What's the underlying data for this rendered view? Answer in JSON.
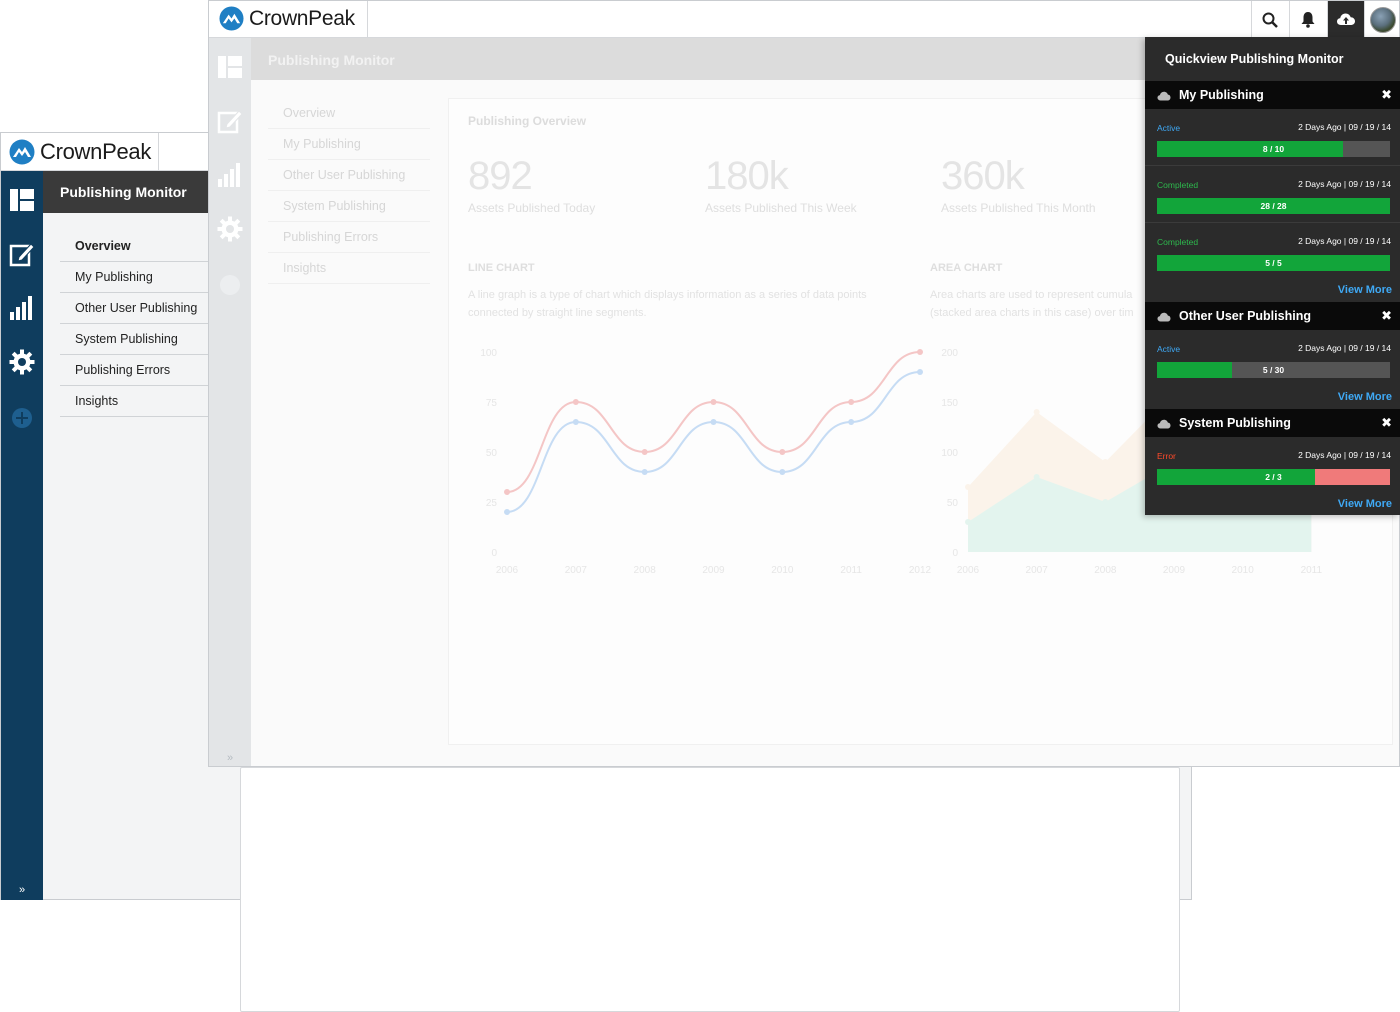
{
  "brand": {
    "name": "CrownPeak"
  },
  "back_window": {
    "title": "Publishing Monitor",
    "nav": [
      "Overview",
      "My Publishing",
      "Other User Publishing",
      "System Publishing",
      "Publishing Errors",
      "Insights"
    ],
    "expand_glyph": "»"
  },
  "front_window": {
    "title": "Publishing Monitor",
    "nav": [
      "Overview",
      "My Publishing",
      "Other User Publishing",
      "System Publishing",
      "Publishing Errors",
      "Insights"
    ],
    "expand_glyph": "»",
    "header_icons": [
      "search-icon",
      "bell-icon",
      "cloud-upload-icon",
      "avatar"
    ],
    "overview": {
      "title": "Publishing Overview",
      "stats": [
        {
          "value": "892",
          "label": "Assets Published Today"
        },
        {
          "value": "180k",
          "label": "Assets Published This Week"
        },
        {
          "value": "360k",
          "label": "Assets Published This Month"
        }
      ],
      "line_chart": {
        "title": "LINE CHART",
        "desc_1": "A line graph is a type of chart which displays information as a series of data points",
        "desc_2": "connected by straight line segments."
      },
      "area_chart": {
        "title": "AREA CHART",
        "desc_1": "Area charts are used to represent cumula",
        "desc_2": "(stacked area charts in this case) over tim"
      }
    }
  },
  "chart_data": [
    {
      "type": "line",
      "title": "LINE CHART",
      "x": [
        "2006",
        "2007",
        "2008",
        "2009",
        "2010",
        "2011",
        "2012"
      ],
      "ylim": [
        0,
        100
      ],
      "yticks": [
        "0",
        "25",
        "50",
        "75",
        "100"
      ],
      "series": [
        {
          "values": [
            30,
            75,
            50,
            75,
            50,
            75,
            100
          ],
          "color": "#f4c6c6"
        },
        {
          "values": [
            20,
            65,
            40,
            65,
            40,
            65,
            90
          ],
          "color": "#c6dcf4"
        }
      ]
    },
    {
      "type": "area",
      "title": "AREA CHART",
      "x": [
        "2006",
        "2007",
        "2008",
        "2009",
        "2010",
        "2011"
      ],
      "ylim": [
        0,
        200
      ],
      "yticks": [
        "0",
        "50",
        "100",
        "150",
        "200"
      ],
      "series": [
        {
          "values": [
            65,
            140,
            90,
            160,
            180,
            190
          ],
          "color": "#fbf3ea"
        },
        {
          "values": [
            30,
            75,
            50,
            90,
            110,
            120
          ],
          "color": "#e3f4ee"
        }
      ]
    }
  ],
  "quickview": {
    "title": "Quickview Publishing Monitor",
    "sections": [
      {
        "name": "My Publishing",
        "items": [
          {
            "status": "Active",
            "status_color": "#3fa9f5",
            "date": "2 Days Ago | 09 / 19 / 14",
            "label": "8 / 10",
            "progress": 0.8,
            "error": false
          },
          {
            "status": "Completed",
            "status_color": "#2db84d",
            "date": "2 Days Ago | 09 / 19 / 14",
            "label": "28 / 28",
            "progress": 1.0,
            "error": false
          },
          {
            "status": "Completed",
            "status_color": "#2db84d",
            "date": "2 Days Ago | 09 / 19 / 14",
            "label": "5 / 5",
            "progress": 1.0,
            "error": false
          }
        ],
        "view_more": "View More"
      },
      {
        "name": "Other User Publishing",
        "items": [
          {
            "status": "Active",
            "status_color": "#3fa9f5",
            "date": "2 Days Ago | 09 / 19 / 14",
            "label": "5 / 30",
            "progress": 0.32,
            "error": false
          }
        ],
        "view_more": "View More"
      },
      {
        "name": "System Publishing",
        "items": [
          {
            "status": "Error",
            "status_color": "#ff4a2b",
            "date": "2 Days Ago | 09 / 19 / 14",
            "label": "2 / 3",
            "progress": 0.68,
            "error": true
          }
        ],
        "view_more": "View More"
      }
    ]
  }
}
